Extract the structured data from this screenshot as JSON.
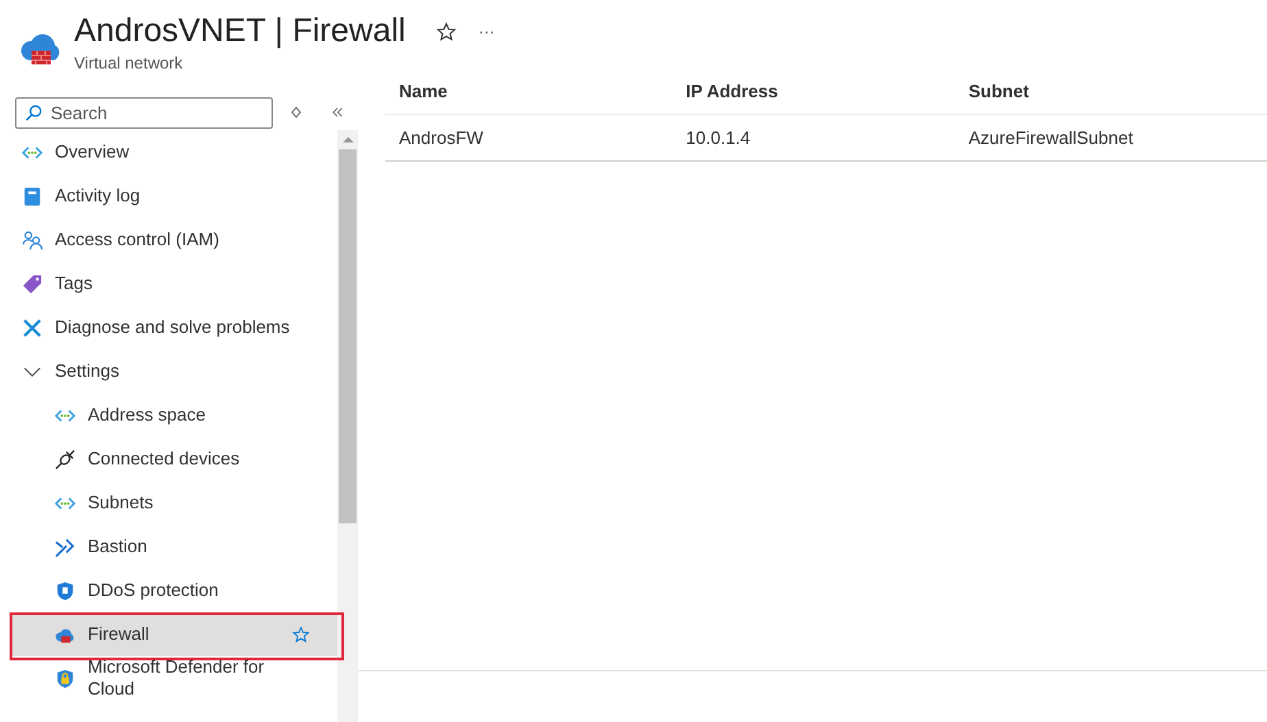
{
  "header": {
    "title": "AndrosVNET | Firewall",
    "subtitle": "Virtual network",
    "favorite": false,
    "more": "···"
  },
  "search": {
    "placeholder": "Search"
  },
  "sidebar": {
    "items": [
      {
        "label": "Overview",
        "kind": "vnet",
        "selected": false
      },
      {
        "label": "Activity log",
        "kind": "log",
        "selected": false
      },
      {
        "label": "Access control (IAM)",
        "kind": "iam",
        "selected": false
      },
      {
        "label": "Tags",
        "kind": "tag",
        "selected": false
      },
      {
        "label": "Diagnose and solve problems",
        "kind": "wrench",
        "selected": false
      },
      {
        "label": "Settings",
        "kind": "group",
        "expanded": true,
        "selected": false,
        "children": [
          {
            "label": "Address space",
            "kind": "vnet",
            "selected": false
          },
          {
            "label": "Connected devices",
            "kind": "plug",
            "selected": false
          },
          {
            "label": "Subnets",
            "kind": "vnet",
            "selected": false
          },
          {
            "label": "Bastion",
            "kind": "bastion",
            "selected": false
          },
          {
            "label": "DDoS protection",
            "kind": "shield",
            "selected": false
          },
          {
            "label": "Firewall",
            "kind": "firewall",
            "selected": true,
            "annotated": true
          },
          {
            "label": "Microsoft Defender for Cloud",
            "kind": "defender",
            "selected": false
          }
        ]
      }
    ]
  },
  "table": {
    "columns": [
      "Name",
      "IP Address",
      "Subnet"
    ],
    "rows": [
      [
        "AndrosFW",
        "10.0.1.4",
        "AzureFirewallSubnet"
      ]
    ]
  }
}
